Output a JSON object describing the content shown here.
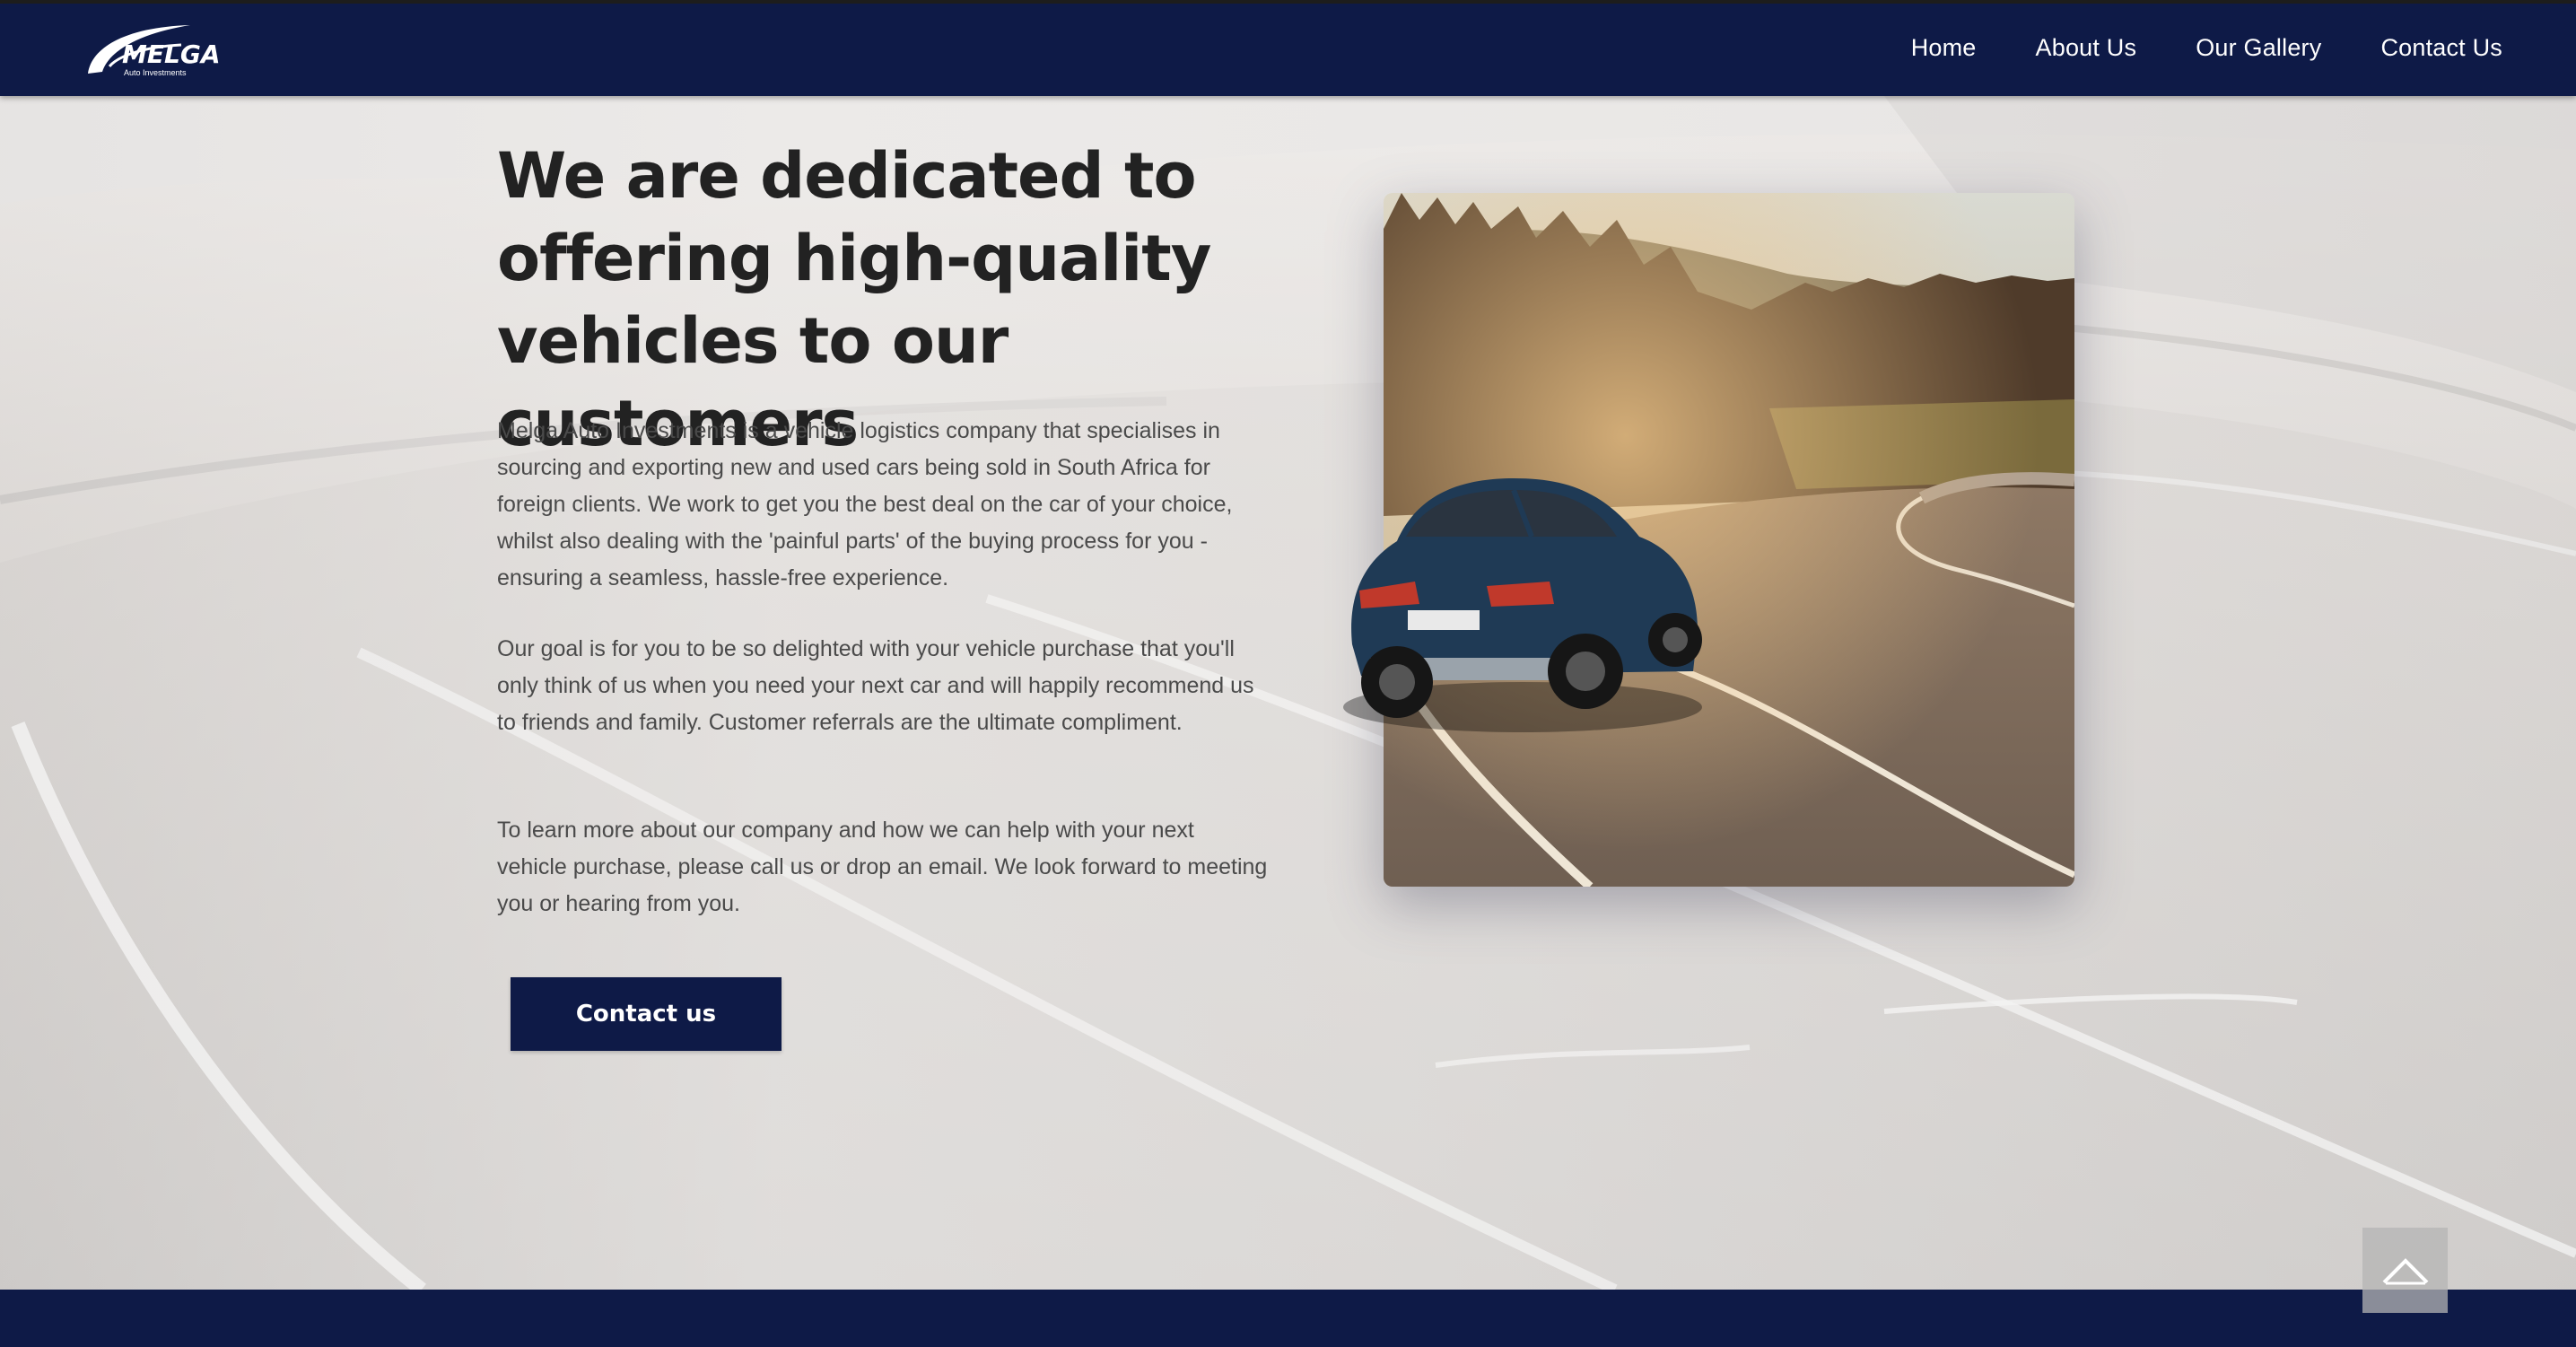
{
  "brand": {
    "logo_text": "MELGA",
    "logo_subtext": "Auto Investments"
  },
  "nav": {
    "items": [
      {
        "label": "Home"
      },
      {
        "label": "About Us"
      },
      {
        "label": "Our Gallery"
      },
      {
        "label": "Contact Us"
      }
    ]
  },
  "hero": {
    "headline": "We are dedicated to offering high-quality vehicles to our customers",
    "paragraphs": [
      "Melga Auto Investments is a vehicle logistics company that specialises in sourcing and exporting new and used cars being sold in South Africa for foreign clients. We work to get you the best deal on the car of your choice, whilst also dealing with the 'painful parts' of the buying process for you - ensuring a seamless, hassle-free experience.",
      "Our goal is for you to be so delighted with your vehicle purchase that you'll only think of us when you need your next car and will happily recommend us to friends and family. Customer referrals are the ultimate compliment.",
      "To learn more about our company and how we can help with your next vehicle purchase, please call us or drop an email. We look forward to meeting you or hearing from you."
    ],
    "cta_label": "Contact us"
  },
  "icons": {
    "back_to_top": "chevron-up-icon"
  },
  "colors": {
    "brand_navy": "#0e1a47",
    "headline": "#222222",
    "body_text": "#4a4a4a"
  }
}
